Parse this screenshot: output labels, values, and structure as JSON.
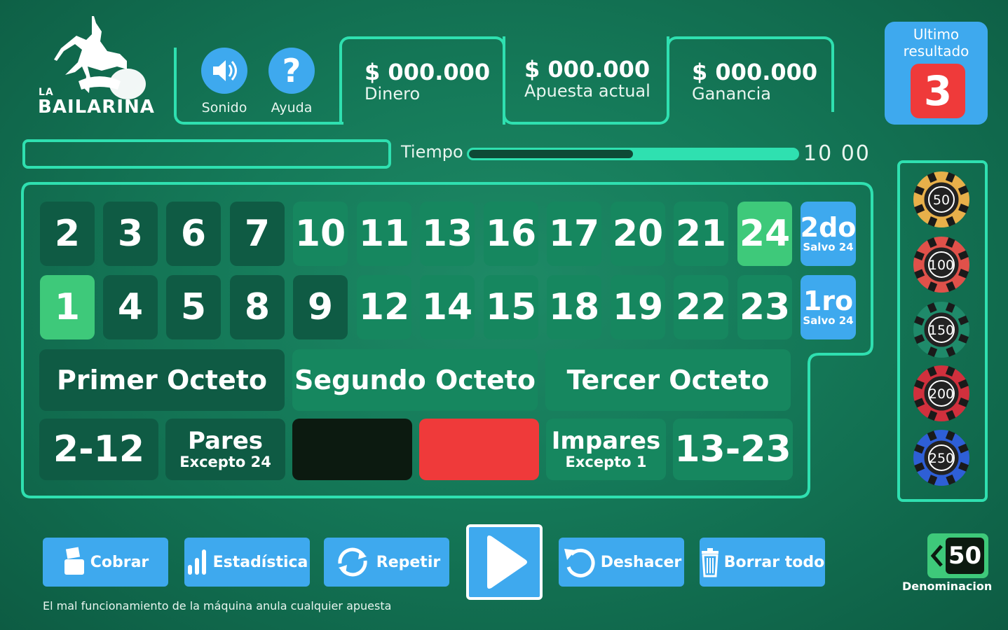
{
  "logo": {
    "line1": "LA",
    "line2": "BAILARINA"
  },
  "controls": {
    "sound_label": "Sonido",
    "help_label": "Ayuda"
  },
  "money": {
    "dinero": {
      "value": "$ 000.000",
      "label": "Dinero"
    },
    "apuesta": {
      "value": "$ 000.000",
      "label": "Apuesta actual"
    },
    "ganancia": {
      "value": "$ 000.000",
      "label": "Ganancia"
    }
  },
  "last_result": {
    "label": "Ultimo resultado",
    "number": "3"
  },
  "timer": {
    "label": "Tiempo",
    "value": "10 00",
    "remaining_fraction": 0.5
  },
  "board": {
    "row1": [
      "2",
      "3",
      "6",
      "7",
      "10",
      "11",
      "13",
      "16",
      "17",
      "20",
      "21",
      "24"
    ],
    "row2": [
      "1",
      "4",
      "5",
      "8",
      "9",
      "12",
      "14",
      "15",
      "18",
      "19",
      "22",
      "23"
    ],
    "side_top": {
      "big": "2do",
      "small": "Salvo 24"
    },
    "side_bottom": {
      "big": "1ro",
      "small": "Salvo 24"
    },
    "octetos": [
      "Primer Octeto",
      "Segundo Octeto",
      "Tercer Octeto"
    ],
    "low": "2-12",
    "pares": {
      "big": "Pares",
      "small": "Excepto 24"
    },
    "impares": {
      "big": "Impares",
      "small": "Excepto 1"
    },
    "high": "13-23",
    "colors": {
      "black": "#0c1a10",
      "red": "#ef3a3a",
      "highlight": "#3ec97a",
      "blue": "#3ea9ee"
    }
  },
  "chips": [
    {
      "value": "50",
      "color": "#e8b04a"
    },
    {
      "value": "100",
      "color": "#e0514a"
    },
    {
      "value": "150",
      "color": "#1f8a6a"
    },
    {
      "value": "200",
      "color": "#d1303d"
    },
    {
      "value": "250",
      "color": "#2e5fd6"
    }
  ],
  "buttons": {
    "cobrar": "Cobrar",
    "estadistica": "Estadística",
    "repetir": "Repetir",
    "deshacer": "Deshacer",
    "borrar": "Borrar todo"
  },
  "denominacion": {
    "value": "50",
    "label": "Denominacion"
  },
  "disclaimer": "El mal funcionamiento de la máquina anula cualquier apuesta"
}
